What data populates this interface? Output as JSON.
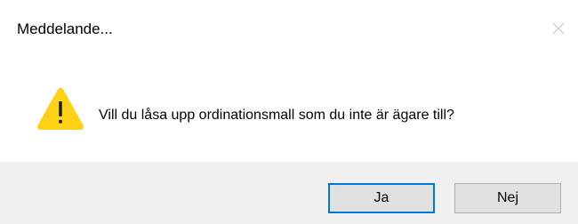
{
  "dialog": {
    "title": "Meddelande...",
    "close_icon": "close-icon",
    "message": "Vill du låsa upp ordinationsmall som du inte är ägare till?",
    "icon": "warning-icon",
    "buttons": {
      "yes_label": "Ja",
      "no_label": "Nej"
    }
  },
  "colors": {
    "footer_bg": "#f0f0f0",
    "button_bg": "#e1e1e1",
    "focus_border": "#0078d7",
    "warning_fill": "#fcd116"
  }
}
